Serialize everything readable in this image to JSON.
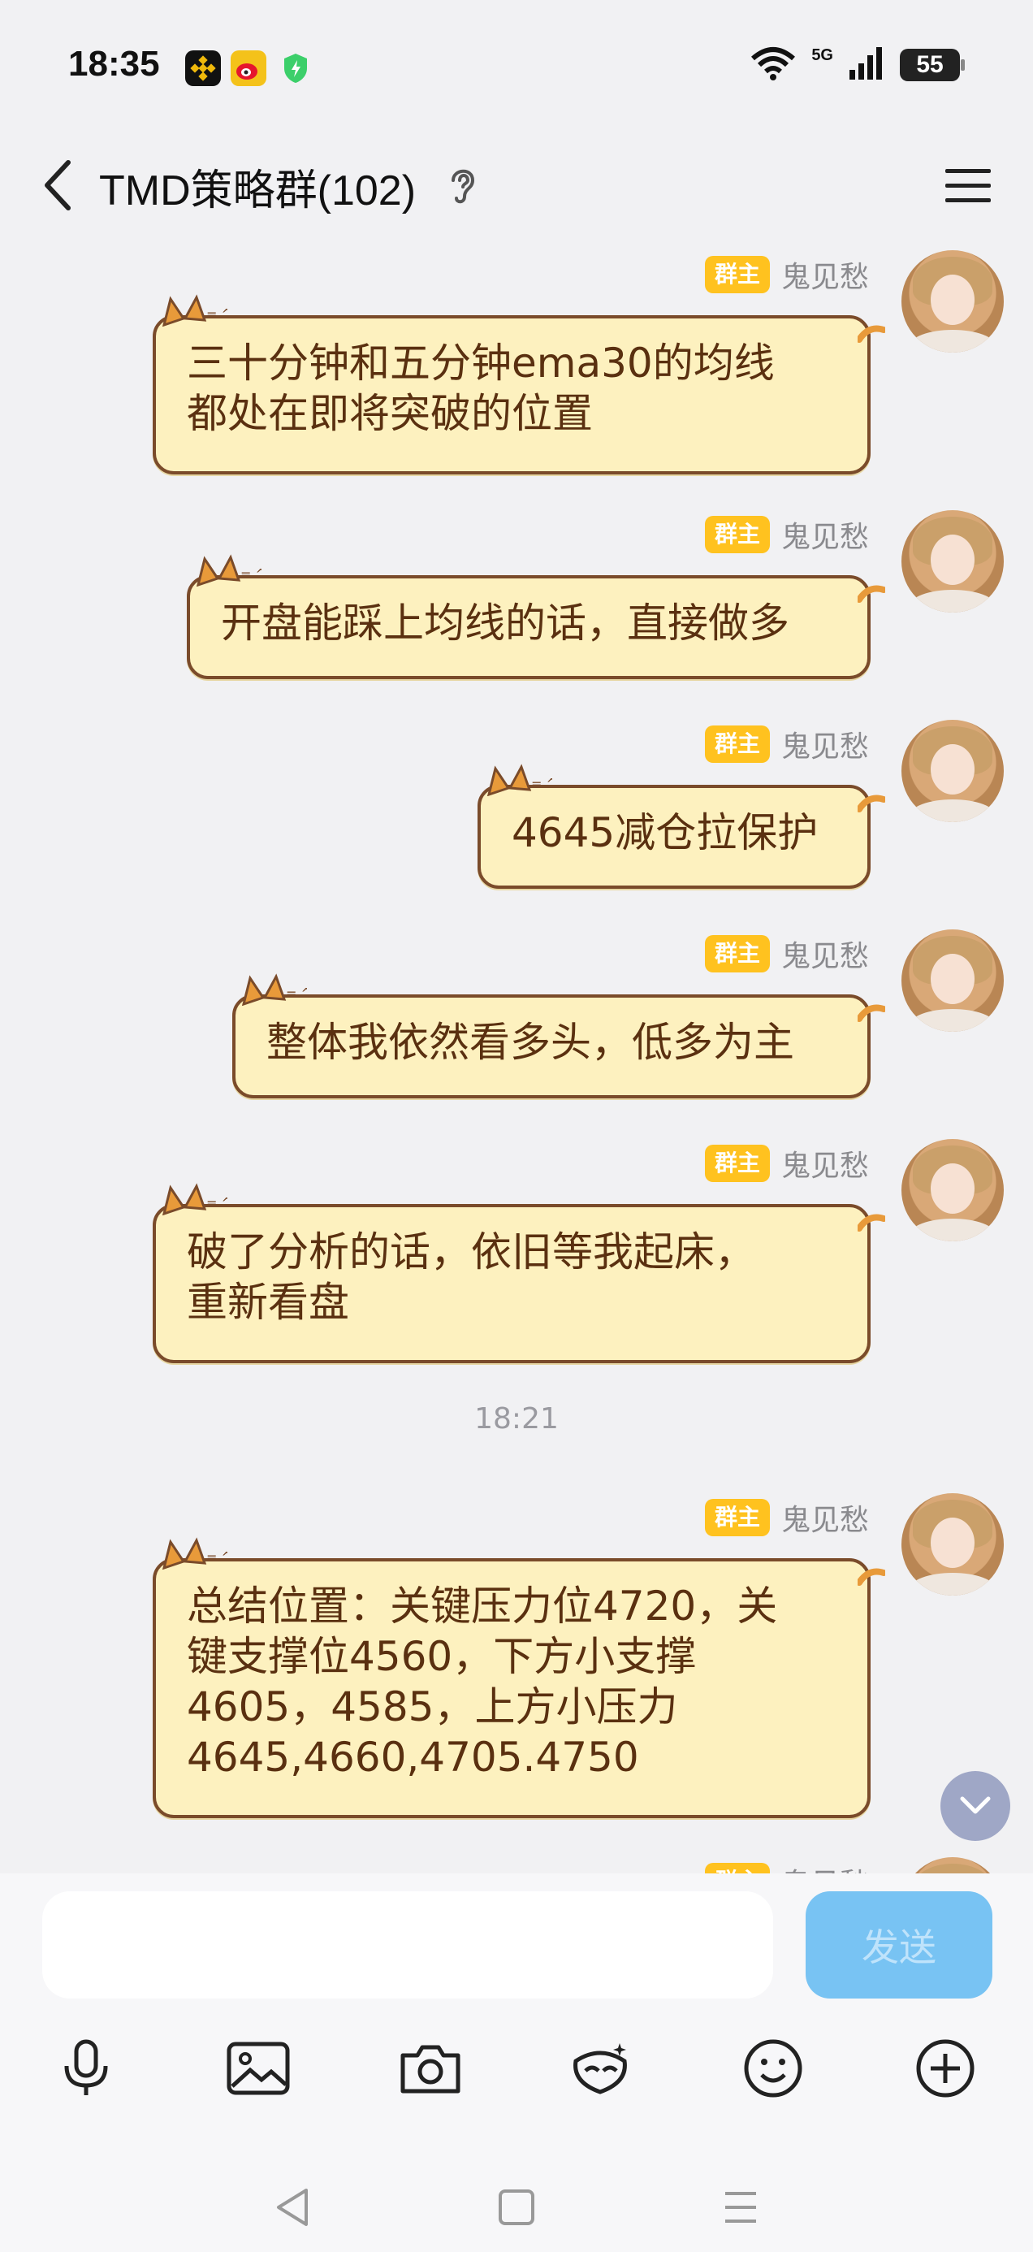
{
  "status_bar": {
    "time": "18:35",
    "network": "5G",
    "battery": "55"
  },
  "header": {
    "title": "TMD策略群(102)"
  },
  "messages": [
    {
      "role_badge": "群主",
      "sender": "鬼见愁",
      "text": "三十分钟和五分钟ema30的均线\n都处在即将突破的位置"
    },
    {
      "role_badge": "群主",
      "sender": "鬼见愁",
      "text": "开盘能踩上均线的话，直接做多"
    },
    {
      "role_badge": "群主",
      "sender": "鬼见愁",
      "text": "4645减仓拉保护"
    },
    {
      "role_badge": "群主",
      "sender": "鬼见愁",
      "text": "整体我依然看多头，低多为主"
    },
    {
      "role_badge": "群主",
      "sender": "鬼见愁",
      "text": "破了分析的话，依旧等我起床，\n重新看盘"
    },
    {
      "role_badge": "群主",
      "sender": "鬼见愁",
      "text": "总结位置：关键压力位4720，关\n键支撑位4560，下方小支撑\n4605，4585，上方小压力\n4645,4660,4705.4750"
    }
  ],
  "timestamp": "18:21",
  "composer": {
    "input_value": "",
    "send_label": "发送"
  },
  "toolbar_icons": [
    "microphone-icon",
    "image-icon",
    "camera-icon",
    "ai-assistant-icon",
    "emoji-icon",
    "plus-icon"
  ],
  "nav_icons": [
    "back-triangle-icon",
    "home-square-icon",
    "menu-lines-icon"
  ],
  "colors": {
    "bubble_bg": "#fdf1bf",
    "bubble_border": "#7a4b2a",
    "badge": "#ffc21f",
    "send_button": "#78c3f3"
  }
}
